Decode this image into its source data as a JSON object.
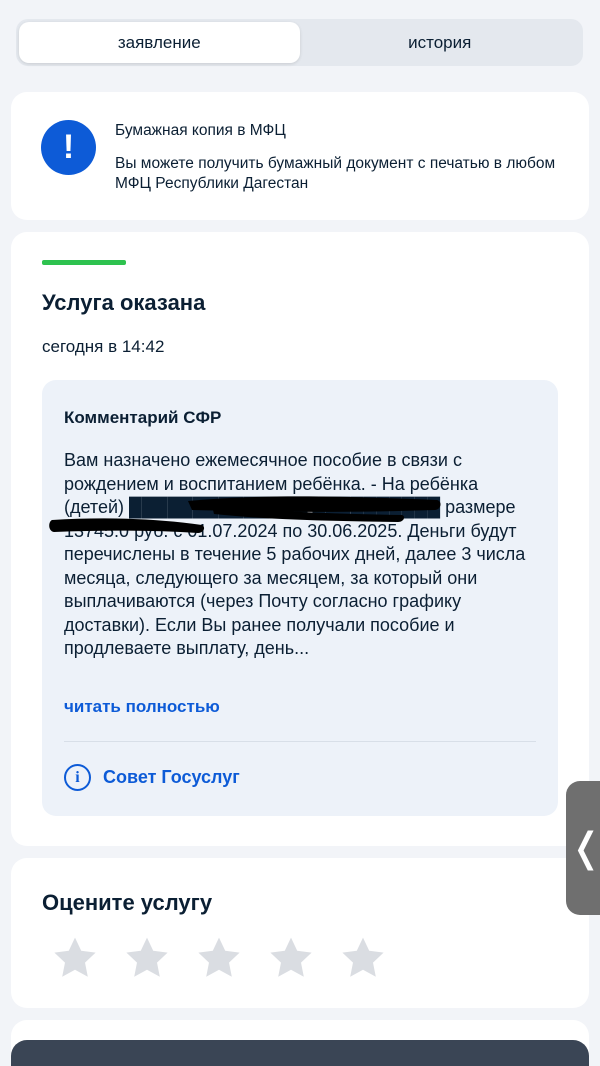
{
  "tabs": [
    {
      "label": "заявление",
      "active": true
    },
    {
      "label": "история",
      "active": false
    }
  ],
  "notice": {
    "icon": "alert-icon",
    "icon_glyph": "!",
    "title": "Бумажная копия в МФЦ",
    "text": "Вы можете получить бумажный документ с печатью в любом МФЦ Республики Дагестан"
  },
  "status": {
    "accent_color": "#2ec24f",
    "title": "Услуга оказана",
    "date": "сегодня в 14:42",
    "comment": {
      "title": "Комментарий СФР",
      "body": "Вам назначено ежемесячное пособие в связи с рождением и воспитанием ребёнка. - На ребёнка (детей) ██████████████ ██████████ размере 13745.0 руб. с 01.07.2024 по 30.06.2025. Деньги будут перечислены в течение 5 рабочих дней, далее 3 числа месяца, следующего за месяцем, за который они выплачиваются (через Почту согласно графику доставки). Если Вы ранее получали пособие и продлеваете выплату, день...",
      "read_more": "читать полностью",
      "advice_icon": "info-icon",
      "advice_icon_glyph": "i",
      "advice": "Совет Госуслуг"
    }
  },
  "rating": {
    "title": "Оцените услугу",
    "stars_total": 5,
    "stars_selected": 0,
    "star_color": "#dadde2"
  },
  "side_handle": {
    "icon": "chevron-left-icon",
    "glyph": "❬"
  },
  "colors": {
    "primary": "#0d5bd7",
    "background": "#f2f4f8",
    "comment_bg": "#edf2f9"
  }
}
